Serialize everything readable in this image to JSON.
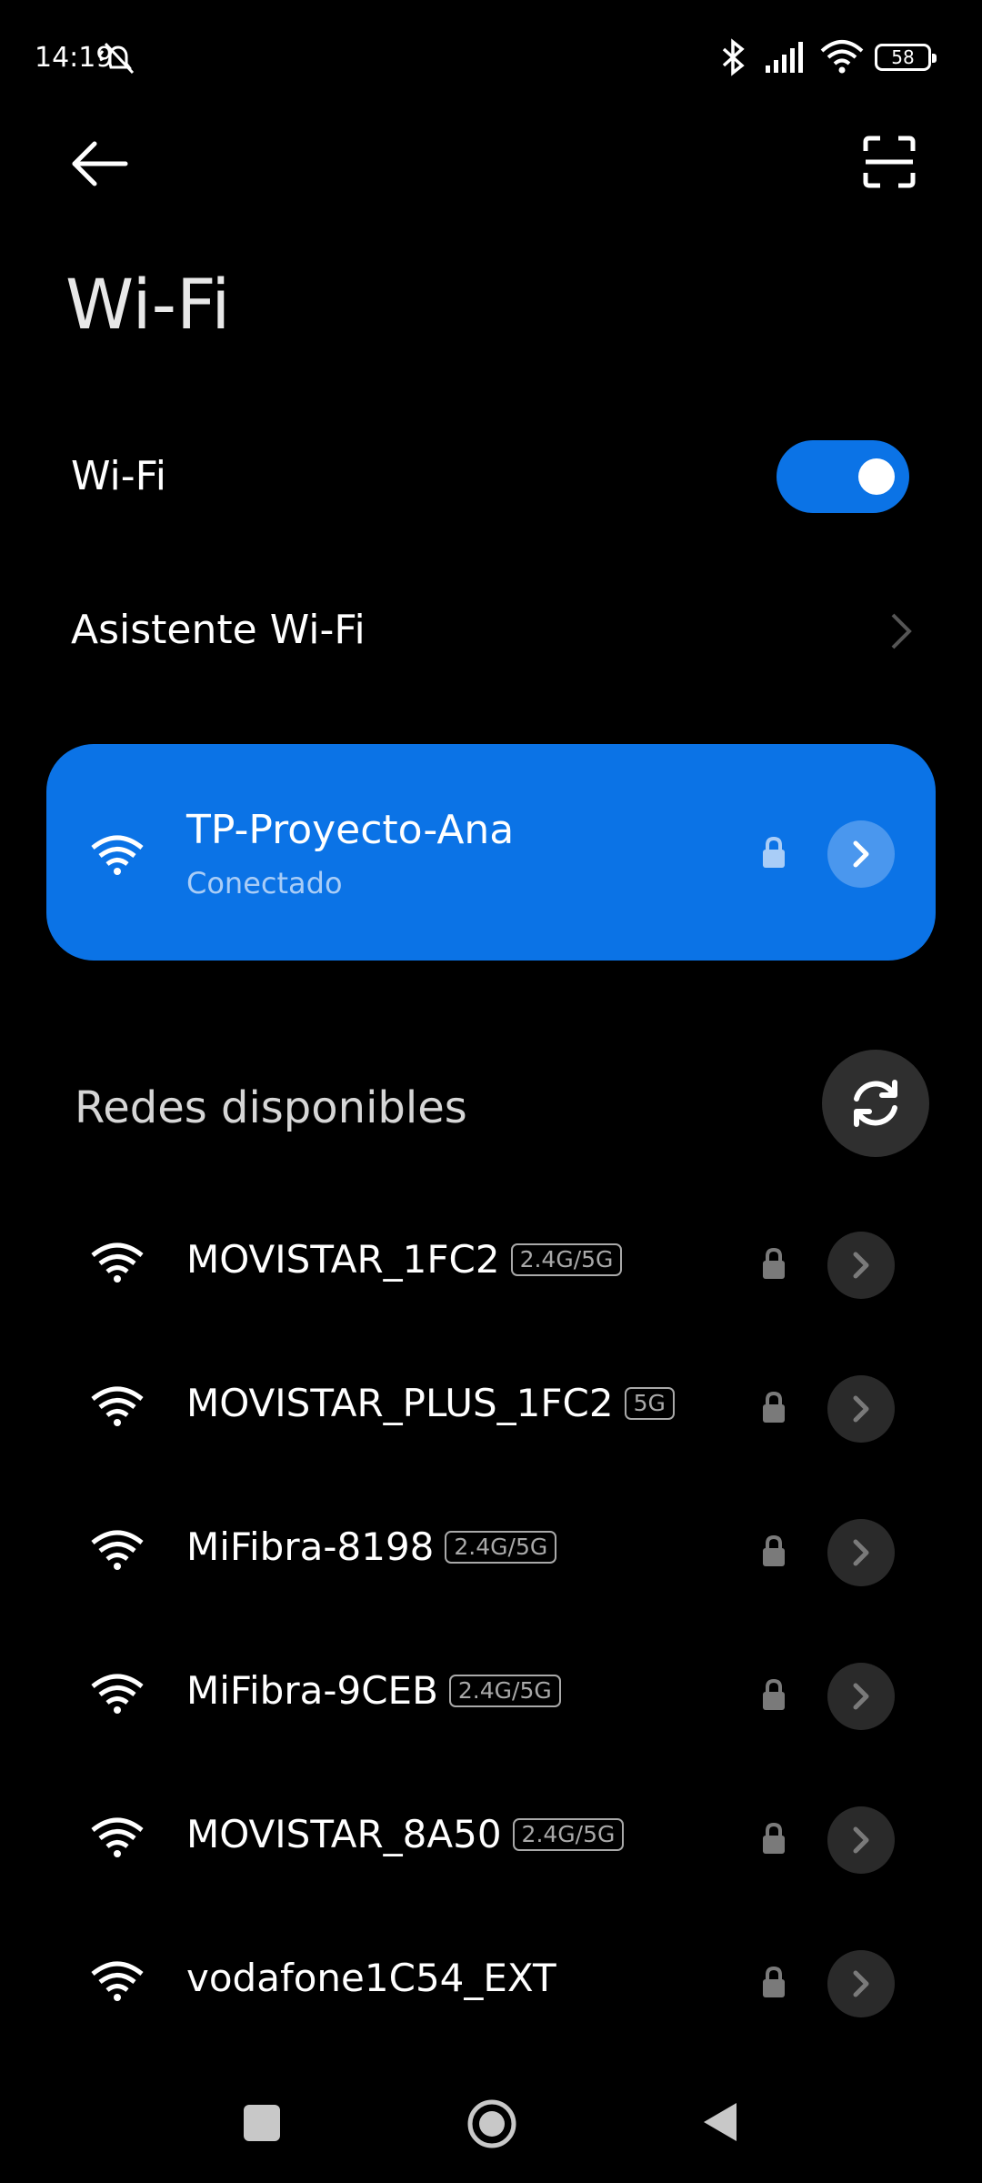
{
  "status_bar": {
    "time": "14:19",
    "battery": "58"
  },
  "header": {
    "title": "Wi-Fi"
  },
  "wifi_toggle": {
    "label": "Wi-Fi",
    "state": "on"
  },
  "assistant": {
    "label": "Asistente Wi-Fi"
  },
  "connected": {
    "name": "TP-Proyecto-Ana",
    "status": "Conectado"
  },
  "available": {
    "title": "Redes disponibles",
    "networks": [
      {
        "name": "MOVISTAR_1FC2",
        "band": "2.4G/5G"
      },
      {
        "name": "MOVISTAR_PLUS_1FC2",
        "band": "5G"
      },
      {
        "name": "MiFibra-8198",
        "band": "2.4G/5G"
      },
      {
        "name": "MiFibra-9CEB",
        "band": "2.4G/5G"
      },
      {
        "name": "MOVISTAR_8A50",
        "band": "2.4G/5G"
      },
      {
        "name": "vodafone1C54_EXT",
        "band": ""
      }
    ]
  },
  "colors": {
    "accent": "#0b73e6",
    "background": "#000000"
  },
  "icons": [
    "mute-icon",
    "bluetooth-icon",
    "signal-icon",
    "wifi-icon",
    "battery-icon",
    "back-arrow-icon",
    "scan-icon",
    "chevron-right-icon",
    "lock-icon",
    "refresh-icon",
    "nav-recents-icon",
    "nav-home-icon",
    "nav-back-icon"
  ]
}
